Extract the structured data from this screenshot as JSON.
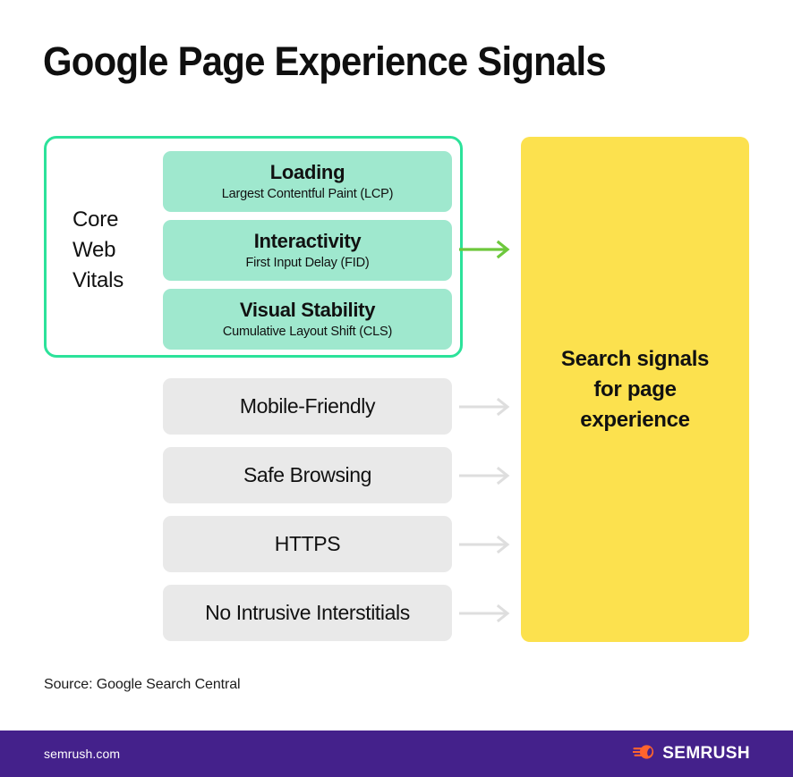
{
  "title": "Google Page Experience Signals",
  "core_web_vitals": {
    "label": "Core\nWeb\nVitals",
    "border_color": "#2ce29a",
    "item_color": "#9fe8ce",
    "items": [
      {
        "title": "Loading",
        "subtitle": "Largest Contentful Paint (LCP)"
      },
      {
        "title": "Interactivity",
        "subtitle": "First Input Delay (FID)"
      },
      {
        "title": "Visual Stability",
        "subtitle": "Cumulative Layout Shift (CLS)"
      }
    ]
  },
  "other_signals": {
    "box_color": "#e9e9e9",
    "arrow_color": "#dedede",
    "items": [
      {
        "label": "Mobile-Friendly"
      },
      {
        "label": "Safe Browsing"
      },
      {
        "label": "HTTPS"
      },
      {
        "label": "No Intrusive Interstitials"
      }
    ]
  },
  "arrows": {
    "green_color": "#6dc83c",
    "gray_color": "#dedede"
  },
  "outcome": {
    "text": "Search signals\nfor page\nexperience",
    "color": "#fce14e"
  },
  "source": "Source: Google Search Central",
  "footer": {
    "url": "semrush.com",
    "brand": "SEMRUSH",
    "background": "#44218b",
    "logo_color": "#ff642d"
  }
}
